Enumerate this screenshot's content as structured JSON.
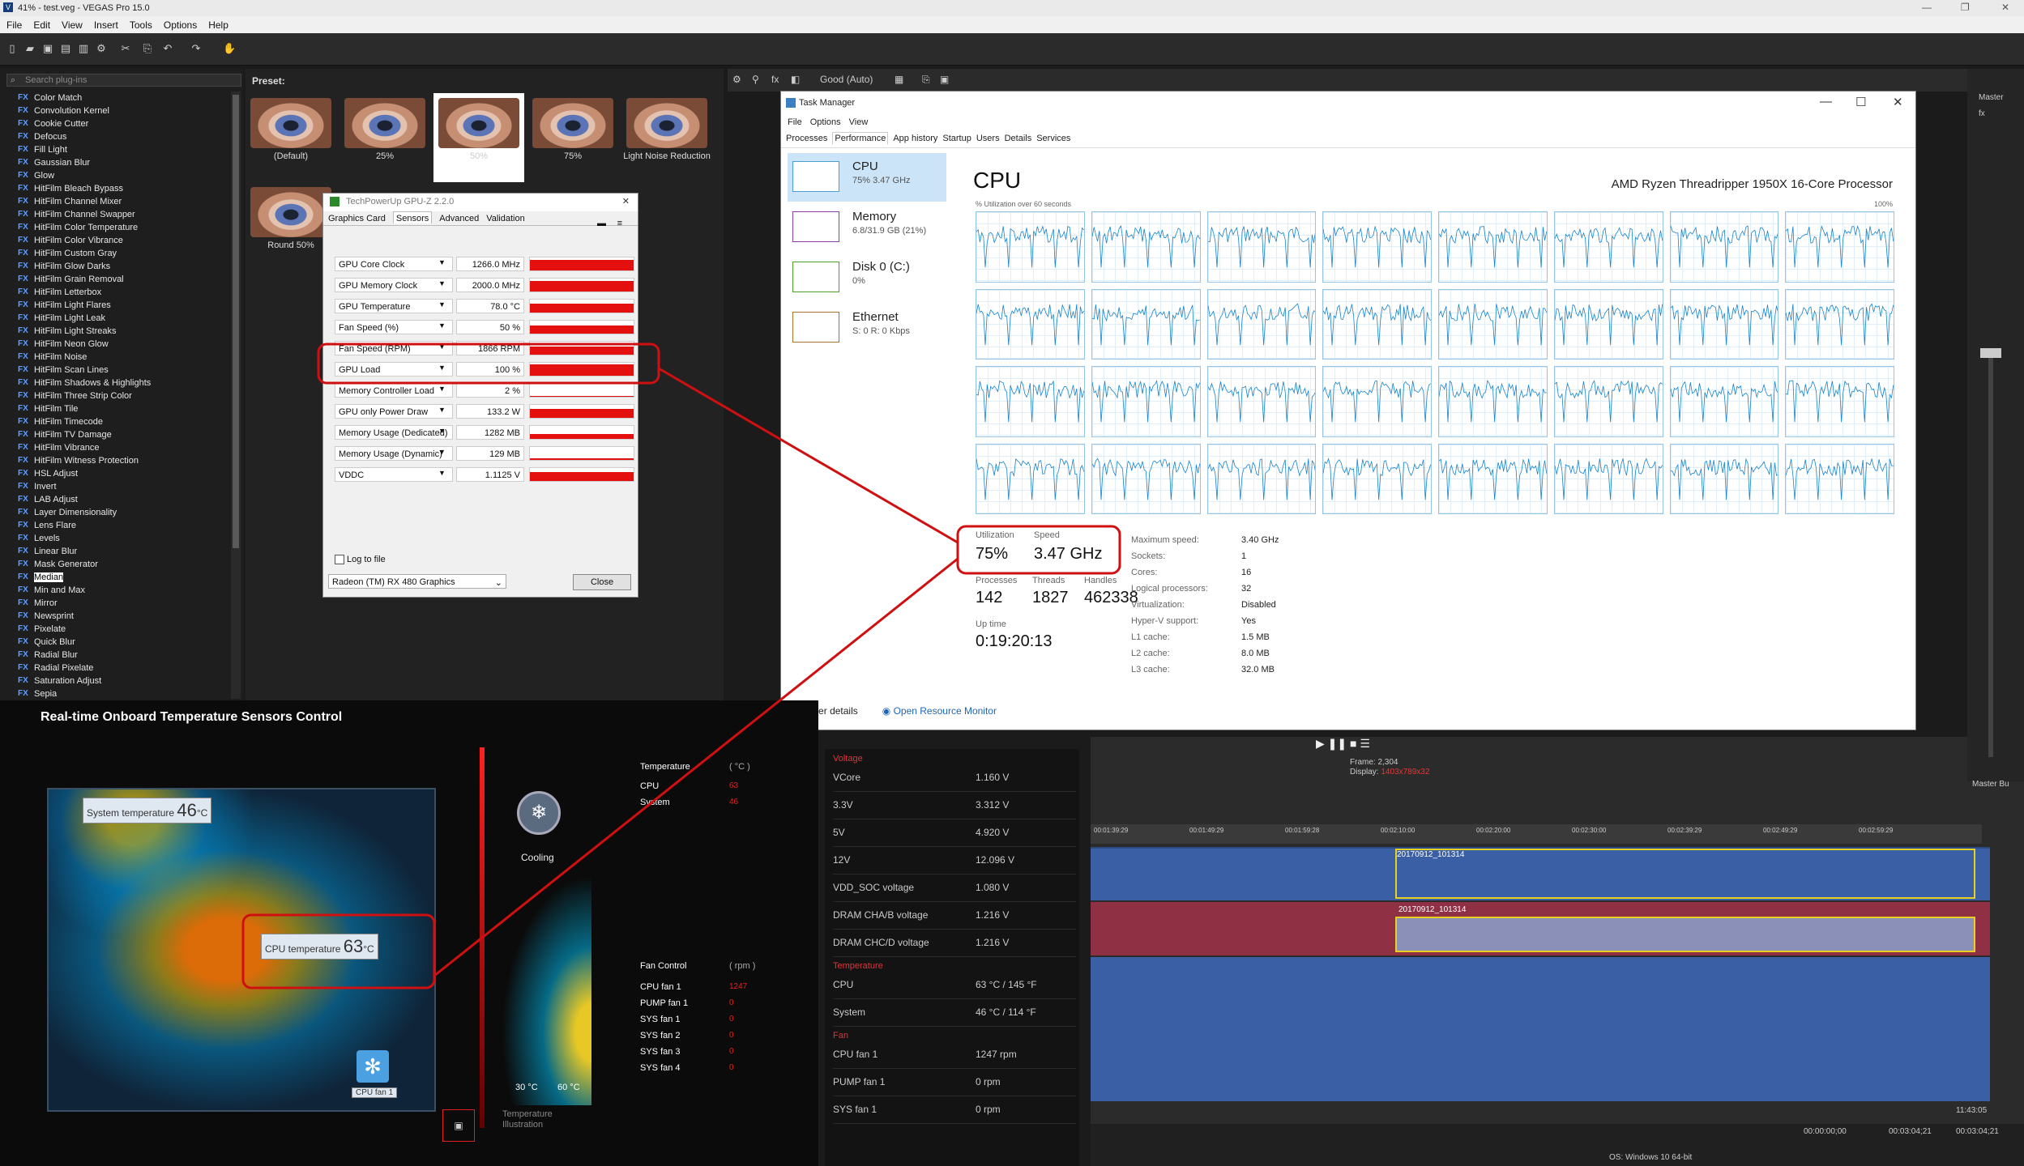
{
  "app": {
    "title": "41% - test.veg - VEGAS Pro 15.0",
    "menu": [
      "File",
      "Edit",
      "View",
      "Insert",
      "Tools",
      "Options",
      "Help"
    ]
  },
  "fx": {
    "search_placeholder": "Search plug-ins",
    "items": [
      "Color Match",
      "Convolution Kernel",
      "Cookie Cutter",
      "Defocus",
      "Fill Light",
      "Gaussian Blur",
      "Glow",
      "HitFilm Bleach Bypass",
      "HitFilm Channel Mixer",
      "HitFilm Channel Swapper",
      "HitFilm Color Temperature",
      "HitFilm Color Vibrance",
      "HitFilm Custom Gray",
      "HitFilm Glow Darks",
      "HitFilm Grain Removal",
      "HitFilm Letterbox",
      "HitFilm Light Flares",
      "HitFilm Light Leak",
      "HitFilm Light Streaks",
      "HitFilm Neon Glow",
      "HitFilm Noise",
      "HitFilm Scan Lines",
      "HitFilm Shadows & Highlights",
      "HitFilm Three Strip Color",
      "HitFilm Tile",
      "HitFilm Timecode",
      "HitFilm TV Damage",
      "HitFilm Vibrance",
      "HitFilm Witness Protection",
      "HSL Adjust",
      "Invert",
      "LAB Adjust",
      "Layer Dimensionality",
      "Lens Flare",
      "Levels",
      "Linear Blur",
      "Mask Generator",
      "Median",
      "Min and Max",
      "Mirror",
      "Newsprint",
      "Pixelate",
      "Quick Blur",
      "Radial Blur",
      "Radial Pixelate",
      "Saturation Adjust",
      "Sepia"
    ],
    "selected": "Median"
  },
  "presets": {
    "label": "Preset:",
    "items": [
      "(Default)",
      "25%",
      "50%",
      "75%",
      "Light Noise Reduction",
      "Round 50%"
    ]
  },
  "gpuz": {
    "title": "TechPowerUp GPU-Z 2.2.0",
    "tabs": [
      "Graphics Card",
      "Sensors",
      "Advanced",
      "Validation"
    ],
    "active_tab": "Sensors",
    "rows": [
      {
        "name": "GPU Core Clock",
        "value": "1266.0 MHz",
        "level": 0.8
      },
      {
        "name": "GPU Memory Clock",
        "value": "2000.0 MHz",
        "level": 0.8
      },
      {
        "name": "GPU Temperature",
        "value": "78.0 °C",
        "level": 0.7
      },
      {
        "name": "Fan Speed (%)",
        "value": "50 %",
        "level": 0.6
      },
      {
        "name": "Fan Speed (RPM)",
        "value": "1866 RPM",
        "level": 0.6
      },
      {
        "name": "GPU Load",
        "value": "100 %",
        "level": 0.9
      },
      {
        "name": "Memory Controller Load",
        "value": "2 %",
        "level": 0.05
      },
      {
        "name": "GPU only Power Draw",
        "value": "133.2 W",
        "level": 0.7
      },
      {
        "name": "Memory Usage (Dedicated)",
        "value": "1282 MB",
        "level": 0.4
      },
      {
        "name": "Memory Usage (Dynamic)",
        "value": "129 MB",
        "level": 0.15
      },
      {
        "name": "VDDC",
        "value": "1.1125 V",
        "level": 0.7
      }
    ],
    "log_label": "Log to file",
    "card": "Radeon (TM) RX 480 Graphics",
    "close": "Close"
  },
  "preview": {
    "quality": "Good (Auto)"
  },
  "taskmgr": {
    "title": "Task Manager",
    "menu": [
      "File",
      "Options",
      "View"
    ],
    "tabs": [
      "Processes",
      "Performance",
      "App history",
      "Startup",
      "Users",
      "Details",
      "Services"
    ],
    "active_tab": "Performance",
    "resources": [
      {
        "name": "CPU",
        "sub": "75% 3.47 GHz"
      },
      {
        "name": "Memory",
        "sub": "6.8/31.9 GB (21%)"
      },
      {
        "name": "Disk 0 (C:)",
        "sub": "0%"
      },
      {
        "name": "Ethernet",
        "sub": "S: 0 R: 0 Kbps"
      }
    ],
    "heading": "CPU",
    "model": "AMD Ryzen Threadripper 1950X 16-Core Processor",
    "util_label": "% Utilization over 60 seconds",
    "util_max": "100%",
    "stats": {
      "utilization_label": "Utilization",
      "utilization": "75%",
      "speed_label": "Speed",
      "speed": "3.47 GHz",
      "processes_label": "Processes",
      "processes": "142",
      "threads_label": "Threads",
      "threads": "1827",
      "handles_label": "Handles",
      "handles": "462338",
      "uptime_label": "Up time",
      "uptime": "0:19:20:13"
    },
    "specs": [
      {
        "k": "Maximum speed:",
        "v": "3.40 GHz"
      },
      {
        "k": "Sockets:",
        "v": "1"
      },
      {
        "k": "Cores:",
        "v": "16"
      },
      {
        "k": "Logical processors:",
        "v": "32"
      },
      {
        "k": "Virtualization:",
        "v": "Disabled"
      },
      {
        "k": "Hyper-V support:",
        "v": "Yes"
      },
      {
        "k": "L1 cache:",
        "v": "1.5 MB"
      },
      {
        "k": "L2 cache:",
        "v": "8.0 MB"
      },
      {
        "k": "L3 cache:",
        "v": "32.0 MB"
      }
    ],
    "fewer": "Fewer details",
    "monitor": "Open Resource Monitor"
  },
  "msi": {
    "title": "Real-time Onboard Temperature Sensors Control",
    "system_temp_label": "System temperature",
    "system_temp": "46",
    "cpu_temp_label": "CPU temperature",
    "cpu_temp": "63",
    "unit": "°C",
    "cpu_fan_tag": "CPU fan 1",
    "cooling": "Cooling",
    "temp_header": "Temperature",
    "temp_unit": "( °C )",
    "temps": [
      {
        "k": "CPU",
        "v": "63"
      },
      {
        "k": "System",
        "v": "46"
      }
    ],
    "fan_header": "Fan Control",
    "fan_unit": "( rpm )",
    "fans": [
      {
        "k": "CPU fan 1",
        "v": "1247"
      },
      {
        "k": "PUMP fan 1",
        "v": "0"
      },
      {
        "k": "SYS fan 1",
        "v": "0"
      },
      {
        "k": "SYS fan 2",
        "v": "0"
      },
      {
        "k": "SYS fan 3",
        "v": "0"
      },
      {
        "k": "SYS fan 4",
        "v": "0"
      }
    ],
    "scale_low": "30 °C",
    "scale_high": "60 °C",
    "illustration": "Temperature\nIllustration"
  },
  "monitor": {
    "voltage_header": "Voltage",
    "voltages": [
      {
        "k": "VCore",
        "v": "1.160 V"
      },
      {
        "k": "3.3V",
        "v": "3.312 V"
      },
      {
        "k": "5V",
        "v": "4.920 V"
      },
      {
        "k": "12V",
        "v": "12.096 V"
      },
      {
        "k": "VDD_SOC voltage",
        "v": "1.080 V"
      },
      {
        "k": "DRAM CHA/B voltage",
        "v": "1.216 V"
      },
      {
        "k": "DRAM CHC/D voltage",
        "v": "1.216 V"
      }
    ],
    "temperature_header": "Temperature",
    "temperatures": [
      {
        "k": "CPU",
        "v": "63 °C / 145 °F"
      },
      {
        "k": "System",
        "v": "46 °C / 114 °F"
      }
    ],
    "fan_header": "Fan",
    "fans": [
      {
        "k": "CPU fan 1",
        "v": "1247 rpm"
      },
      {
        "k": "PUMP fan 1",
        "v": "0 rpm"
      },
      {
        "k": "SYS fan 1",
        "v": "0 rpm"
      }
    ]
  },
  "timeline": {
    "frame_label": "Frame:",
    "frame": "2,304",
    "display_label": "Display:",
    "display": "1403x789x32",
    "ruler": [
      "00:01:39:29",
      "00:01:49:29",
      "00:01:59:28",
      "00:02:10:00",
      "00:02:20:00",
      "00:02:30:00",
      "00:02:39:29",
      "00:02:49:29",
      "00:02:59:29"
    ],
    "clip": "20170912_101314",
    "time_start": "00:00:00;00",
    "time_end": "00:03:04;21",
    "time_len": "00:03:04;21",
    "clock": "11:43:05",
    "os": "OS: Windows 10 64-bit",
    "master": "Master",
    "master_bus": "Master Bu"
  }
}
